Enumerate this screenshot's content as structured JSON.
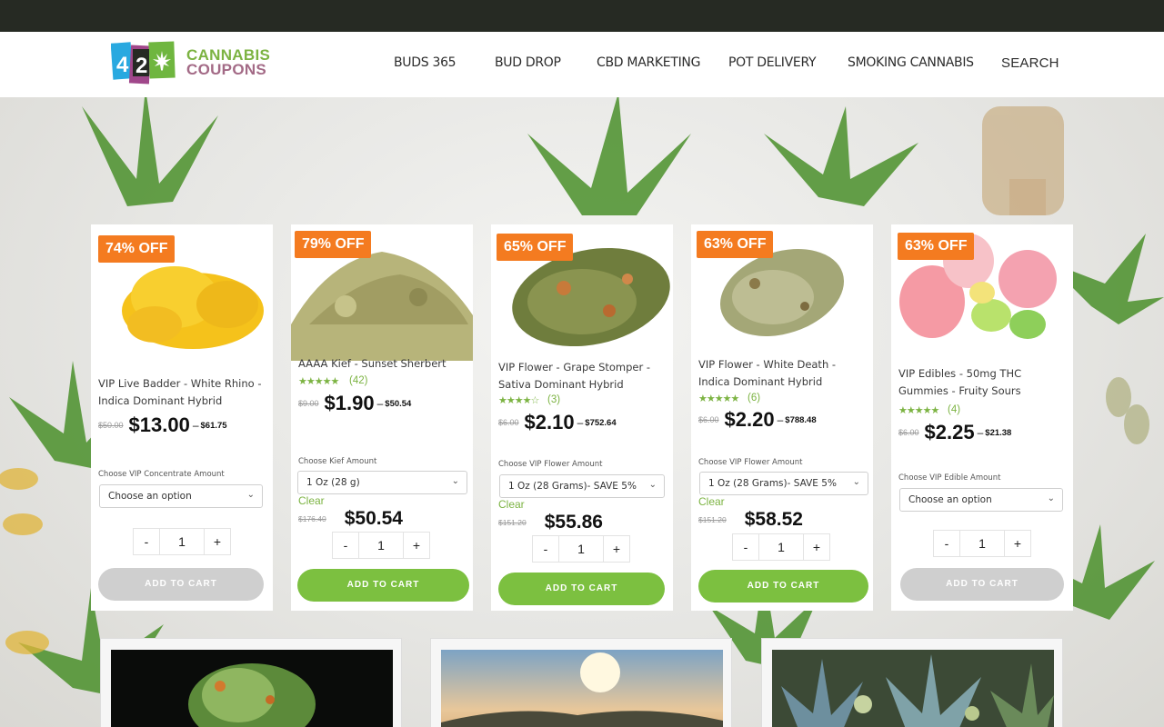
{
  "site": {
    "logo_top": "CANNABIS",
    "logo_bottom": "COUPONS",
    "logo_badge": "420"
  },
  "nav": [
    {
      "label": "BUDS 365"
    },
    {
      "label": "BUD DROP"
    },
    {
      "label": "CBD MARKETING"
    },
    {
      "label": "POT DELIVERY"
    },
    {
      "label": "SMOKING CANNABIS"
    },
    {
      "label": "SEARCH"
    }
  ],
  "colors": {
    "accent_green": "#7cc040",
    "badge_orange": "#f47b20",
    "top_bar": "#262a23"
  },
  "products": [
    {
      "badge": "74% OFF",
      "title": "VIP Live Badder - White Rhino - Indica Dominant Hybrid",
      "rating": "",
      "rating_count": "",
      "old_price": "$50.00",
      "price": "$13.00",
      "max_price": "$61.75",
      "option_label": "Choose VIP Concentrate Amount",
      "option_value": "Choose an option",
      "clear": "",
      "variation_old": "",
      "variation_price": "",
      "qty": "1",
      "minus": "-",
      "plus": "+",
      "cart": "ADD TO CART"
    },
    {
      "badge": "79% OFF",
      "title": "AAAA Kief - Sunset Sherbert",
      "rating": "★★★★★",
      "rating_count": "(42)",
      "old_price": "$9.00",
      "price": "$1.90",
      "max_price": "$50.54",
      "option_label": "Choose Kief Amount",
      "option_value": "1 Oz (28 g)",
      "clear": "Clear",
      "variation_old": "$176.40",
      "variation_price": "$50.54",
      "qty": "1",
      "minus": "-",
      "plus": "+",
      "cart": "ADD TO CART"
    },
    {
      "badge": "65% OFF",
      "title": "VIP Flower - Grape Stomper - Sativa Dominant Hybrid",
      "rating": "★★★★☆",
      "rating_count": "(3)",
      "old_price": "$6.00",
      "price": "$2.10",
      "max_price": "$752.64",
      "option_label": "Choose VIP Flower Amount",
      "option_value": "1 Oz (28 Grams)- SAVE 5%",
      "clear": "Clear",
      "variation_old": "$151.20",
      "variation_price": "$55.86",
      "qty": "1",
      "minus": "-",
      "plus": "+",
      "cart": "ADD TO CART"
    },
    {
      "badge": "63% OFF",
      "title": "VIP Flower - White Death - Indica Dominant Hybrid",
      "rating": "★★★★★",
      "rating_count": "(6)",
      "old_price": "$6.00",
      "price": "$2.20",
      "max_price": "$788.48",
      "option_label": "Choose VIP Flower Amount",
      "option_value": "1 Oz (28 Grams)- SAVE 5%",
      "clear": "Clear",
      "variation_old": "$151.20",
      "variation_price": "$58.52",
      "qty": "1",
      "minus": "-",
      "plus": "+",
      "cart": "ADD TO CART"
    },
    {
      "badge": "63% OFF",
      "title": "VIP Edibles - 50mg THC Gummies - Fruity Sours",
      "rating": "★★★★★",
      "rating_count": "(4)",
      "old_price": "$6.00",
      "price": "$2.25",
      "max_price": "$21.38",
      "option_label": "Choose VIP Edible Amount",
      "option_value": "Choose an option",
      "clear": "",
      "variation_old": "",
      "variation_price": "",
      "qty": "1",
      "minus": "-",
      "plus": "+",
      "cart": "ADD TO CART"
    }
  ]
}
